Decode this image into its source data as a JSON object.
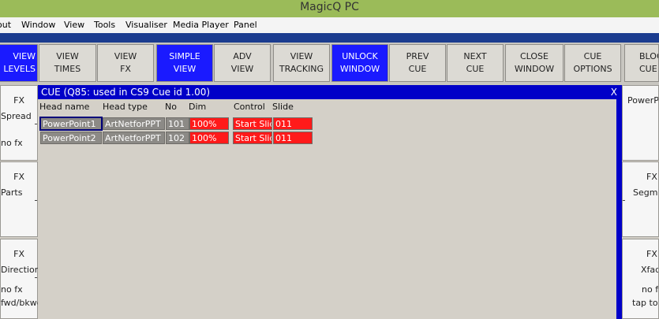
{
  "app": {
    "title": "MagicQ PC"
  },
  "menu": [
    "out",
    "Window",
    "View",
    "Tools",
    "Visualiser",
    "Media Player",
    "Panel"
  ],
  "toolbar": [
    {
      "l1": "VIEW",
      "l2": "LEVELS",
      "active": true
    },
    {
      "l1": "VIEW",
      "l2": "TIMES",
      "active": false
    },
    {
      "l1": "VIEW",
      "l2": "FX",
      "active": false
    },
    {
      "l1": "SIMPLE",
      "l2": "VIEW",
      "active": true
    },
    {
      "l1": "ADV",
      "l2": "VIEW",
      "active": false
    },
    {
      "l1": "VIEW",
      "l2": "TRACKING",
      "active": false
    },
    {
      "l1": "UNLOCK",
      "l2": "WINDOW",
      "active": true
    },
    {
      "l1": "PREV",
      "l2": "CUE",
      "active": false
    },
    {
      "l1": "NEXT",
      "l2": "CUE",
      "active": false
    },
    {
      "l1": "CLOSE",
      "l2": "WINDOW",
      "active": false
    },
    {
      "l1": "CUE",
      "l2": "OPTIONS",
      "active": false
    },
    {
      "l1": "BLOCK",
      "l2": "CUE",
      "active": false
    }
  ],
  "left_buttons": [
    {
      "l1": "FX",
      "l2": "Spread",
      "l3": "no fx"
    },
    {
      "l1": "FX",
      "l2": "Parts",
      "l3": ""
    },
    {
      "l1": "FX",
      "l2": "Direction",
      "l3": "no fx",
      "l4": "fwd/bkwd"
    }
  ],
  "right_buttons": [
    {
      "l1": "PowerPoint"
    },
    {
      "l1": "FX",
      "l2": "Segments"
    },
    {
      "l1": "FX",
      "l2": "Xfade",
      "l3": "no fx",
      "l4": "tap to t"
    }
  ],
  "cue_window": {
    "title": "CUE (Q85:  used in CS9 Cue id 1.00)",
    "close": "X",
    "headers": [
      "Head name",
      "Head type",
      "No",
      "Dim",
      "Control",
      "Slide"
    ],
    "rows": [
      {
        "name": "PowerPoint1",
        "type": "ArtNetforPPT",
        "no": "101",
        "dim": "100%",
        "control": "Start Slide",
        "slide": "011"
      },
      {
        "name": "PowerPoint2",
        "type": "ArtNetforPPT",
        "no": "102",
        "dim": "100%",
        "control": "Start Slide",
        "slide": "011"
      }
    ]
  },
  "colors": {
    "titlebar": "#9bbb59",
    "active_button": "#1a1aff",
    "window_title": "#0000c8",
    "red_cell": "#ff1a1a"
  }
}
